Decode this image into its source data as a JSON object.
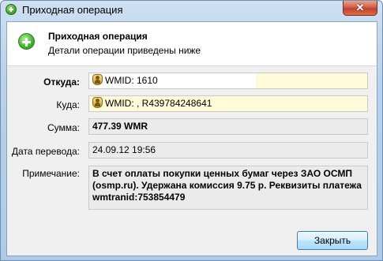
{
  "window": {
    "title": "Приходная операция",
    "close_glyph": "✕"
  },
  "header": {
    "title": "Приходная операция",
    "subtitle": "Детали операции приведены ниже"
  },
  "fields": {
    "from": {
      "label": "Откуда:",
      "value": "WMID: 1610"
    },
    "to": {
      "label": "Куда:",
      "value": "WMID: , R439784248641"
    },
    "amount": {
      "label": "Сумма:",
      "value": "477.39 WMR"
    },
    "date": {
      "label": "Дата перевода:",
      "value": "24.09.12 19:56"
    },
    "note": {
      "label": "Примечание:",
      "value": "В счет оплаты покупки ценных бумаг через ЗАО ОСМП (osmp.ru). Удержана комиссия 9.75 р. Реквизиты платежа wmtranid:753854479"
    }
  },
  "buttons": {
    "close_label": "Закрыть"
  },
  "icons": {
    "title_icon": "plus-circle-icon",
    "header_icon": "plus-circle-icon",
    "wmid_icon": "webmoney-passport-icon"
  },
  "colors": {
    "title_bar": "#b9d1ea",
    "close_red": "#c3432d",
    "field_yellow": "#fffbd9",
    "button_blue": "#bee6fd"
  }
}
